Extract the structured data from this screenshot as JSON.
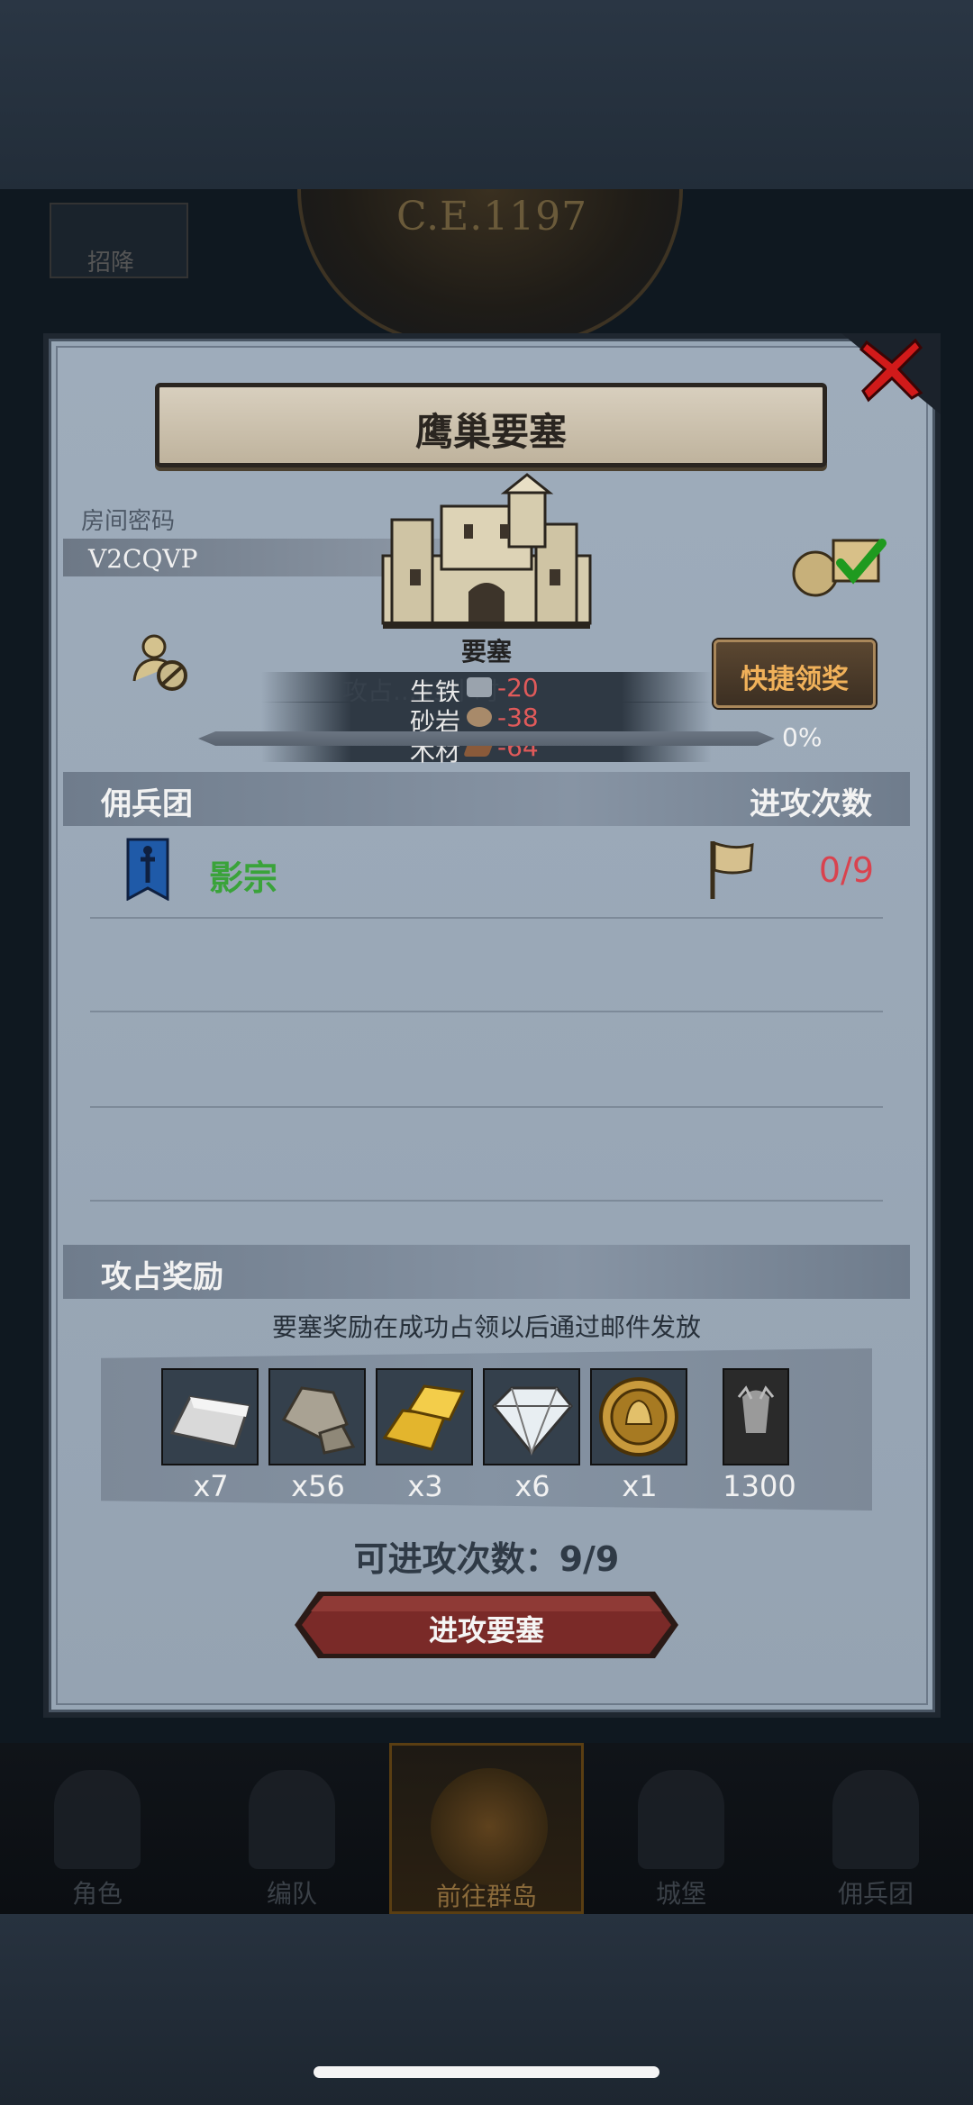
{
  "background": {
    "era": "C.E.1197",
    "left_tab_text": "招降",
    "nav": [
      {
        "label": "角色",
        "icon": "knight-icon"
      },
      {
        "label": "编队",
        "icon": "helmet-icon"
      },
      {
        "label": "前往群岛",
        "icon": "compass-icon"
      },
      {
        "label": "城堡",
        "icon": "castle-icon"
      },
      {
        "label": "佣兵团",
        "icon": "mercenary-icon"
      }
    ]
  },
  "dialog": {
    "title": "鹰巢要塞",
    "room_label": "房间密码",
    "room_code": "V2CQVP",
    "fortress_label": "要塞",
    "quick_claim": "快捷领奖",
    "occupy_ghost_text": "攻占...23小时",
    "resources": [
      {
        "name": "生铁",
        "value": "-20",
        "color": "#9aa3ad"
      },
      {
        "name": "砂岩",
        "value": "-38",
        "color": "#a88a6a"
      },
      {
        "name": "木材",
        "value": "-64",
        "color": "#8a5a3a"
      }
    ],
    "progress": {
      "percent": 0,
      "label": "0%"
    },
    "mercenary_section": {
      "title": "佣兵团",
      "right_title": "进攻次数"
    },
    "guild": {
      "name": "影宗",
      "attack_count": "0/9"
    },
    "reward_section": {
      "title": "攻占奖励",
      "note": "要塞奖励在成功占领以后通过邮件发放",
      "items": [
        {
          "name": "iron-ingot-icon",
          "qty": "x7"
        },
        {
          "name": "stone-icon",
          "qty": "x56"
        },
        {
          "name": "gold-bar-icon",
          "qty": "x3"
        },
        {
          "name": "diamond-icon",
          "qty": "x6"
        },
        {
          "name": "medal-icon",
          "qty": "x1"
        },
        {
          "name": "honor-icon",
          "qty": "1300"
        }
      ]
    },
    "attempts_text": "可进攻次数：9/9",
    "attack_button": "进攻要塞"
  }
}
